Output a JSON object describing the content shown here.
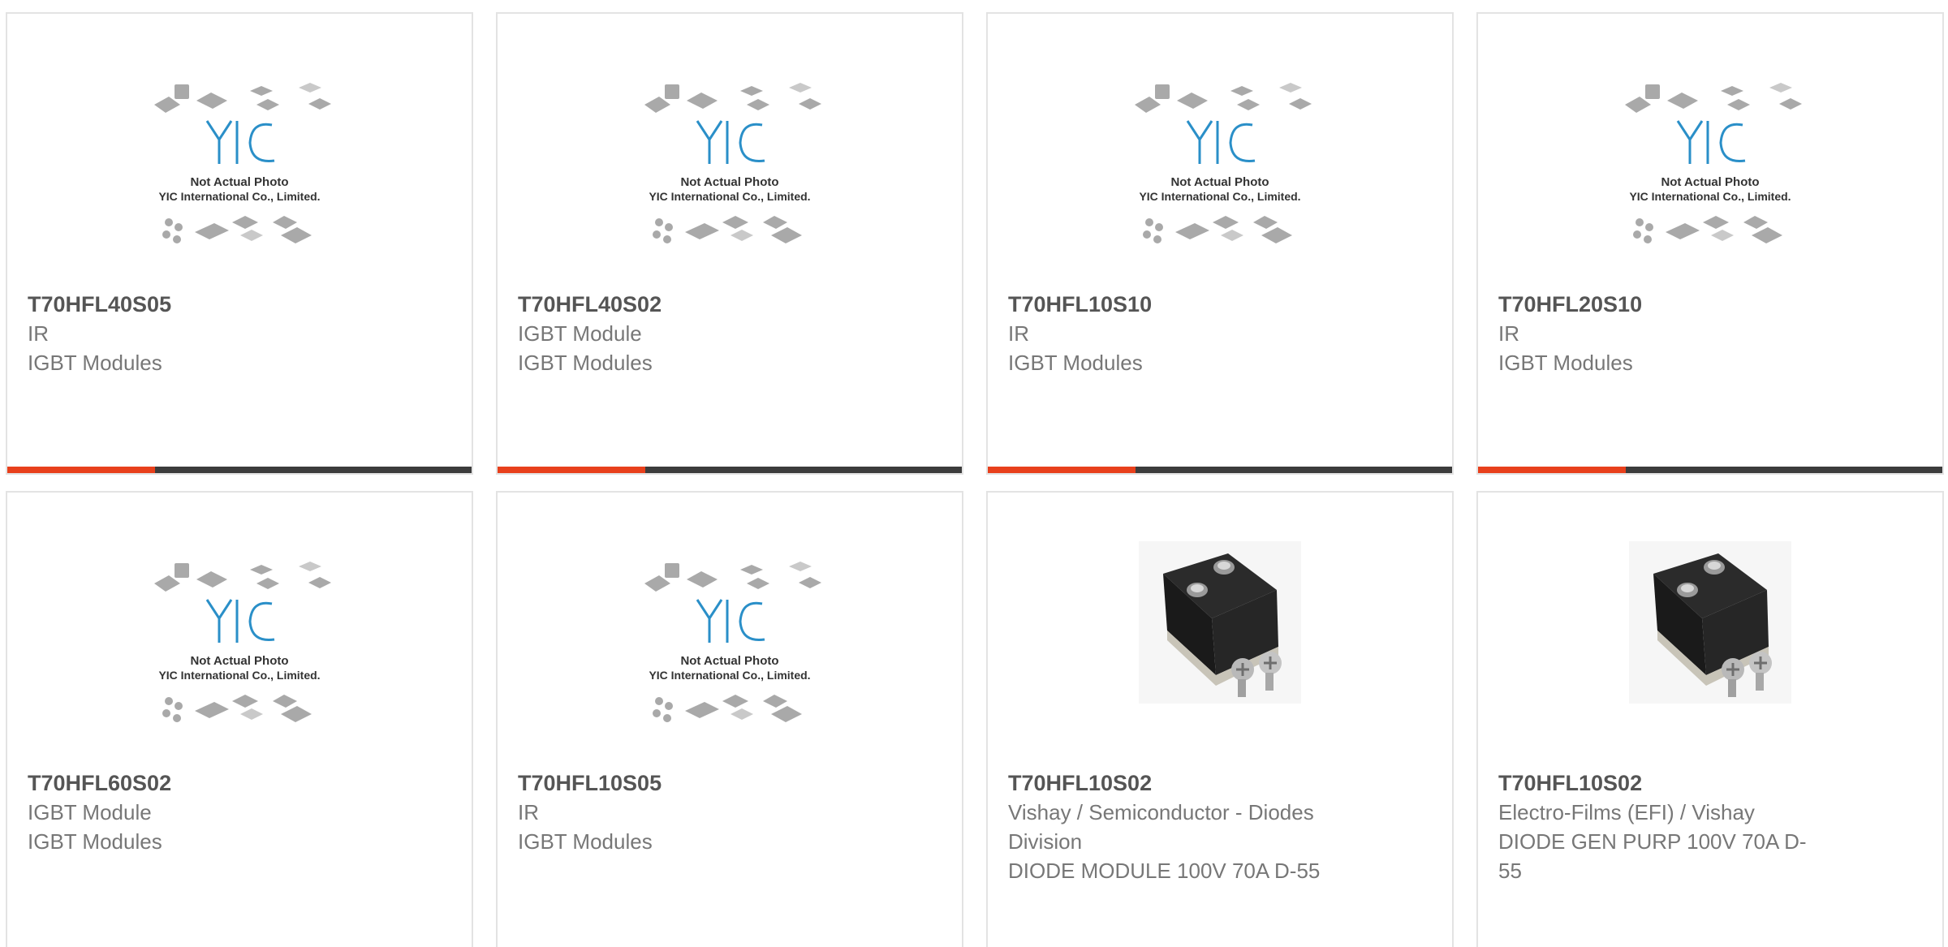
{
  "cards": [
    {
      "part": "T70HFL40S05",
      "line1": "IR",
      "line2": "IGBT Modules",
      "line3": "",
      "image": "placeholder-not-actual-photo"
    },
    {
      "part": "T70HFL40S02",
      "line1": "IGBT Module",
      "line2": "IGBT Modules",
      "line3": "",
      "image": "placeholder-not-actual-photo"
    },
    {
      "part": "T70HFL10S10",
      "line1": "IR",
      "line2": "IGBT Modules",
      "line3": "",
      "image": "placeholder-not-actual-photo"
    },
    {
      "part": "T70HFL20S10",
      "line1": "IR",
      "line2": "IGBT Modules",
      "line3": "",
      "image": "placeholder-not-actual-photo"
    },
    {
      "part": "T70HFL60S02",
      "line1": "IGBT Module",
      "line2": "IGBT Modules",
      "line3": "",
      "image": "placeholder-not-actual-photo"
    },
    {
      "part": "T70HFL10S05",
      "line1": "IR",
      "line2": "IGBT Modules",
      "line3": "",
      "image": "placeholder-not-actual-photo"
    },
    {
      "part": "T70HFL10S02",
      "line1": "Vishay / Semiconductor - Diodes",
      "line2": "Division",
      "line3": "DIODE MODULE 100V 70A D-55",
      "image": "diode-module-photo"
    },
    {
      "part": "T70HFL10S02",
      "line1": "Electro-Films (EFI) / Vishay",
      "line2": "DIODE GEN PURP 100V 70A D-",
      "line3": "55",
      "image": "diode-module-photo"
    }
  ],
  "placeholder": {
    "logo": "YIC",
    "caption1": "Not Actual Photo",
    "caption2": "YIC International Co., Limited."
  },
  "colors": {
    "accent": "#e8401c",
    "bar": "#3c3c3c",
    "logo_blue": "#2a8fc8",
    "border": "#e3e3e3"
  }
}
